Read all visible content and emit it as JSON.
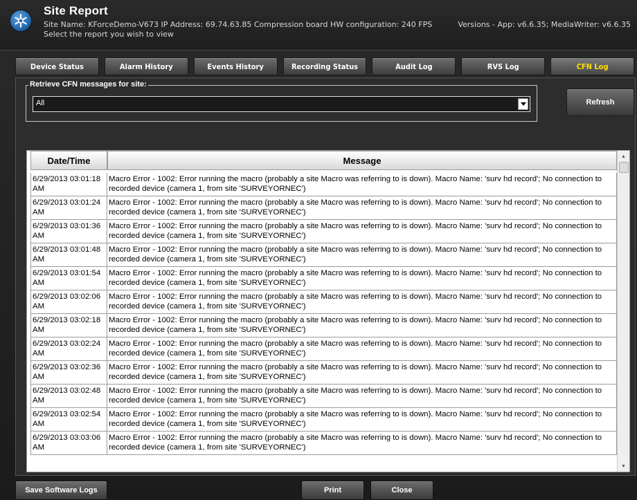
{
  "header": {
    "title": "Site Report",
    "info": "Site Name: KForceDemo-V673   IP Address: 69.74.63.85   Compression board HW configuration: 240 FPS",
    "versions": "Versions - App: v6.6.35; MediaWriter: v6.6.35",
    "instruction": "Select the report you wish to view",
    "logo_icon": "snowflake-icon"
  },
  "tabs": [
    {
      "label": "Device Status"
    },
    {
      "label": "Alarm History"
    },
    {
      "label": "Events History"
    },
    {
      "label": "Recording Status"
    },
    {
      "label": "Audit Log"
    },
    {
      "label": "RVS Log"
    },
    {
      "label": "CFN Log"
    }
  ],
  "active_tab": "CFN Log",
  "filter": {
    "group_label": "Retrieve CFN messages for site:",
    "selected": "All"
  },
  "refresh_label": "Refresh",
  "table": {
    "columns": [
      "Date/Time",
      "Message"
    ],
    "rows": [
      {
        "dt": "6/29/2013 03:01:18 AM",
        "msg": "Macro Error - 1002: Error running the macro (probably a site Macro was referring to is down). Macro Name: 'surv hd record'; No connection to recorded device (camera 1, from site 'SURVEYORNEC')"
      },
      {
        "dt": "6/29/2013 03:01:24 AM",
        "msg": "Macro Error - 1002: Error running the macro (probably a site Macro was referring to is down). Macro Name: 'surv hd record'; No connection to recorded device (camera 1, from site 'SURVEYORNEC')"
      },
      {
        "dt": "6/29/2013 03:01:36 AM",
        "msg": "Macro Error - 1002: Error running the macro (probably a site Macro was referring to is down). Macro Name: 'surv hd record'; No connection to recorded device (camera 1, from site 'SURVEYORNEC')"
      },
      {
        "dt": "6/29/2013 03:01:48 AM",
        "msg": "Macro Error - 1002: Error running the macro (probably a site Macro was referring to is down). Macro Name: 'surv hd record'; No connection to recorded device (camera 1, from site 'SURVEYORNEC')"
      },
      {
        "dt": "6/29/2013 03:01:54 AM",
        "msg": "Macro Error - 1002: Error running the macro (probably a site Macro was referring to is down). Macro Name: 'surv hd record'; No connection to recorded device (camera 1, from site 'SURVEYORNEC')"
      },
      {
        "dt": "6/29/2013 03:02:06 AM",
        "msg": "Macro Error - 1002: Error running the macro (probably a site Macro was referring to is down). Macro Name: 'surv hd record'; No connection to recorded device (camera 1, from site 'SURVEYORNEC')"
      },
      {
        "dt": "6/29/2013 03:02:18 AM",
        "msg": "Macro Error - 1002: Error running the macro (probably a site Macro was referring to is down). Macro Name: 'surv hd record'; No connection to recorded device (camera 1, from site 'SURVEYORNEC')"
      },
      {
        "dt": "6/29/2013 03:02:24 AM",
        "msg": "Macro Error - 1002: Error running the macro (probably a site Macro was referring to is down). Macro Name: 'surv hd record'; No connection to recorded device (camera 1, from site 'SURVEYORNEC')"
      },
      {
        "dt": "6/29/2013 03:02:36 AM",
        "msg": "Macro Error - 1002: Error running the macro (probably a site Macro was referring to is down). Macro Name: 'surv hd record'; No connection to recorded device (camera 1, from site 'SURVEYORNEC')"
      },
      {
        "dt": "6/29/2013 03:02:48 AM",
        "msg": "Macro Error - 1002: Error running the macro (probably a site Macro was referring to is down). Macro Name: 'surv hd record'; No connection to recorded device (camera 1, from site 'SURVEYORNEC')"
      },
      {
        "dt": "6/29/2013 03:02:54 AM",
        "msg": "Macro Error - 1002: Error running the macro (probably a site Macro was referring to is down). Macro Name: 'surv hd record'; No connection to recorded device (camera 1, from site 'SURVEYORNEC')"
      },
      {
        "dt": "6/29/2013 03:03:06 AM",
        "msg": "Macro Error - 1002: Error running the macro (probably a site Macro was referring to is down). Macro Name: 'surv hd record'; No connection to recorded device (camera 1, from site 'SURVEYORNEC')"
      }
    ]
  },
  "footer": {
    "save_logs_label": "Save Software Logs",
    "print_label": "Print",
    "close_label": "Close"
  },
  "colors": {
    "active_tab_text": "#ffe000",
    "background": "#1b1b1b",
    "panel": "#2d2d2d"
  }
}
